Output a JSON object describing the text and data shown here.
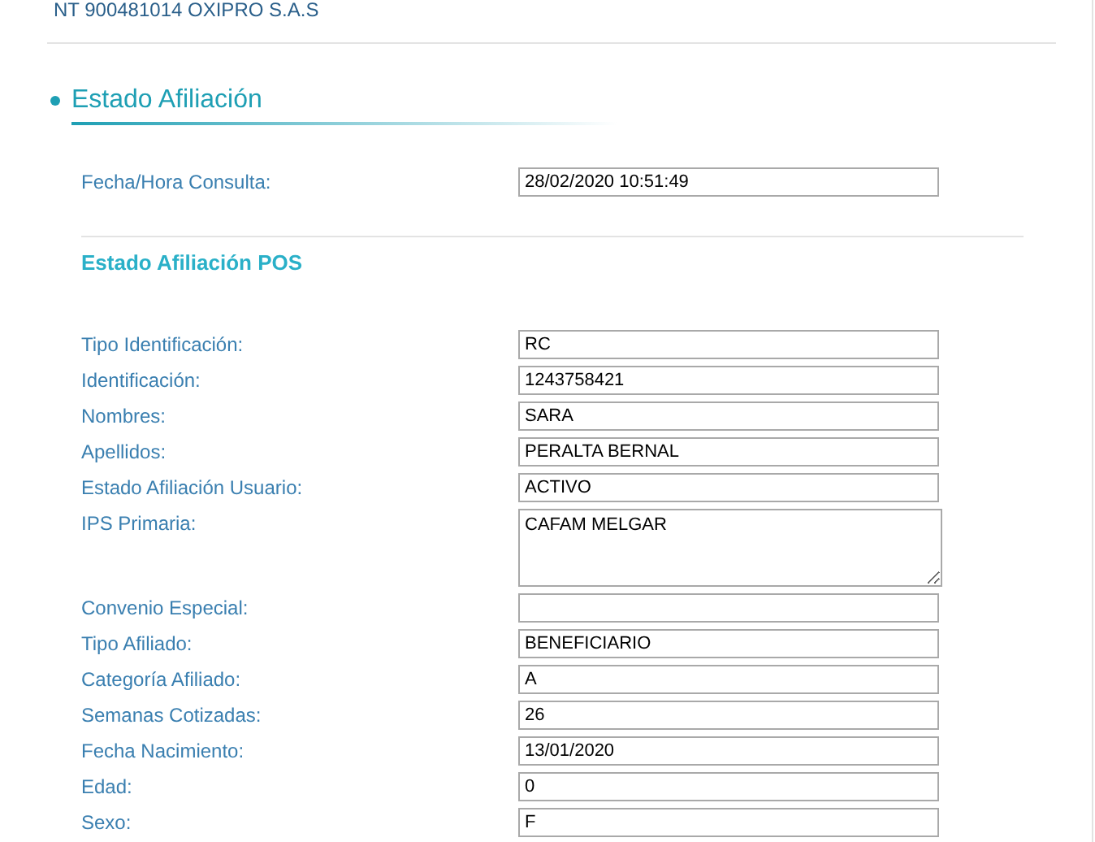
{
  "company_line": "NT 900481014 OXIPRO S.A.S",
  "section_title": "Estado Afiliación",
  "query": {
    "label": "Fecha/Hora Consulta:",
    "value": "28/02/2020 10:51:49"
  },
  "subsection_title": "Estado Afiliación POS",
  "fields": [
    {
      "kind": "input",
      "label": "Tipo Identificación:",
      "value": "RC"
    },
    {
      "kind": "input",
      "label": "Identificación:",
      "value": "1243758421"
    },
    {
      "kind": "input",
      "label": "Nombres:",
      "value": "SARA"
    },
    {
      "kind": "input",
      "label": "Apellidos:",
      "value": "PERALTA BERNAL"
    },
    {
      "kind": "input",
      "label": "Estado Afiliación Usuario:",
      "value": "ACTIVO"
    },
    {
      "kind": "textarea",
      "label": "IPS Primaria:",
      "value": "CAFAM MELGAR"
    },
    {
      "kind": "input",
      "label": "Convenio Especial:"
    },
    {
      "kind": "input",
      "label": "Tipo Afiliado:",
      "value": "BENEFICIARIO"
    },
    {
      "kind": "input",
      "label": "Categoría Afiliado:",
      "value": "A"
    },
    {
      "kind": "input",
      "label": "Semanas Cotizadas:",
      "value": "26"
    },
    {
      "kind": "input",
      "label": "Fecha Nacimiento:",
      "value": "13/01/2020"
    },
    {
      "kind": "input",
      "label": "Edad:",
      "value": "0"
    },
    {
      "kind": "input",
      "label": "Sexo:",
      "value": "F"
    }
  ]
}
